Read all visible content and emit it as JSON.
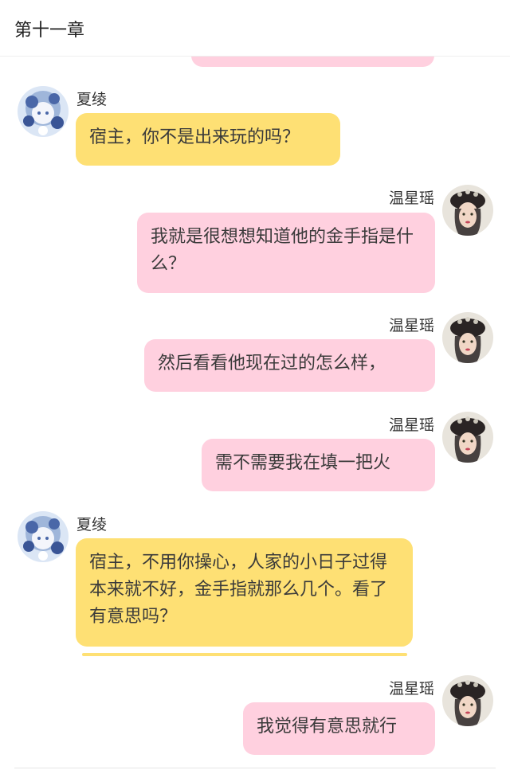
{
  "header": {
    "title": "第十一章"
  },
  "characters": {
    "system": {
      "name": "夏绫"
    },
    "host": {
      "name": "温星瑶"
    }
  },
  "messages": [
    {
      "sender": "夏绫",
      "side": "left",
      "text": "宿主，你不是出来玩的吗？"
    },
    {
      "sender": "温星瑶",
      "side": "right",
      "text": "我就是很想想知道他的金手指是什么？"
    },
    {
      "sender": "温星瑶",
      "side": "right",
      "text": "然后看看他现在过的怎么样，"
    },
    {
      "sender": "温星瑶",
      "side": "right",
      "text": "需不需要我在填一把火"
    },
    {
      "sender": "夏绫",
      "side": "left",
      "text": "宿主，不用你操心，人家的小日子过得本来就不好，金手指就那么几个。看了有意思吗？"
    },
    {
      "sender": "温星瑶",
      "side": "right",
      "text": "我觉得有意思就行"
    }
  ],
  "colors": {
    "yellow_bubble": "#fee074",
    "pink_bubble": "#ffd0df"
  },
  "icons": {
    "system_avatar": "anime-girl-avatar-icon",
    "host_avatar": "portrait-avatar-icon"
  }
}
